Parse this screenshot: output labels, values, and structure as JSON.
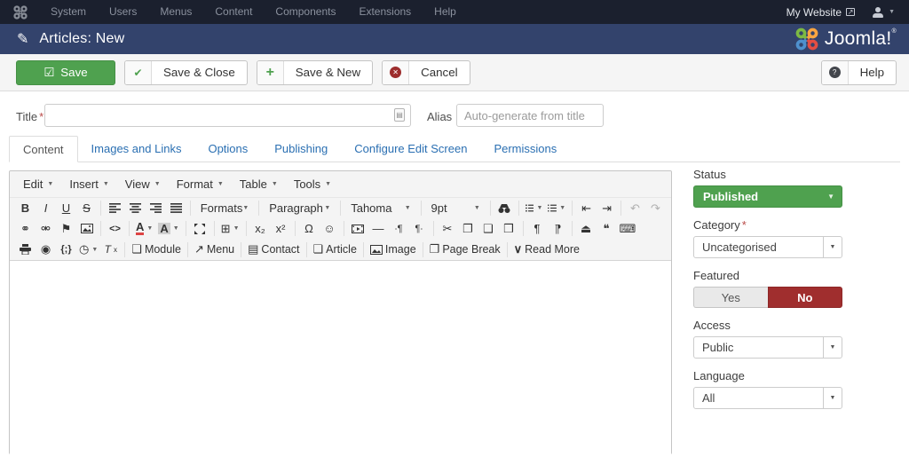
{
  "topbar": {
    "menu": [
      "System",
      "Users",
      "Menus",
      "Content",
      "Components",
      "Extensions",
      "Help"
    ],
    "site_link": "My Website"
  },
  "header": {
    "title": "Articles: New",
    "logo_text": "Joomla!",
    "logo_reg": "®"
  },
  "toolbar": {
    "save": "Save",
    "save_close": "Save & Close",
    "save_new": "Save & New",
    "cancel": "Cancel",
    "help": "Help"
  },
  "form": {
    "title_label": "Title",
    "required_mark": "*",
    "alias_label": "Alias",
    "alias_placeholder": "Auto-generate from title"
  },
  "tabs": [
    "Content",
    "Images and Links",
    "Options",
    "Publishing",
    "Configure Edit Screen",
    "Permissions"
  ],
  "editor": {
    "menubar": [
      "Edit",
      "Insert",
      "View",
      "Format",
      "Table",
      "Tools"
    ],
    "dropdowns": {
      "formats": "Formats",
      "paragraph": "Paragraph",
      "font": "Tahoma",
      "size": "9pt"
    },
    "insert_buttons": {
      "module": "Module",
      "menu": "Menu",
      "contact": "Contact",
      "article": "Article",
      "image": "Image",
      "page_break": "Page Break",
      "read_more": "Read More"
    }
  },
  "icons": {
    "caret": "▼",
    "pencil": "✎",
    "external_arrow": "↗",
    "save_check": "☑",
    "check": "✔",
    "plus": "+",
    "cross": "✕",
    "question": "?",
    "bold": "B",
    "italic": "I",
    "underline": "U",
    "strike": "S",
    "undo": "↶",
    "redo": "↷",
    "outdent": "⇤",
    "indent": "⇥",
    "link": "⚭",
    "unlink": "⚮",
    "anchor": "⚑",
    "code": "<>",
    "forecolor": "A",
    "backcolor": "A",
    "table": "⊞",
    "subscript": "x₂",
    "superscript": "x²",
    "omega": "Ω",
    "smiley": "☺",
    "hr": "—",
    "nbsp_before": "∙¶",
    "nbsp_after": "¶∙",
    "cut": "✂",
    "copy": "❐",
    "paste": "❑",
    "paste_text": "❒",
    "paragraph_ltr": "¶",
    "paragraph_rtl": "¶",
    "page_up": "⏏",
    "blockquote": "❝",
    "template": "⌨",
    "preview": "◉",
    "source_code": "{;}",
    "clock": "◷",
    "clear_t": "T",
    "clear_x": "x",
    "module": "❏",
    "menu_out": "↗",
    "contact": "▤",
    "article": "❏",
    "pagebreak": "❐",
    "readmore": "∨",
    "field_addon": "▤"
  },
  "sidebar": {
    "status_label": "Status",
    "status_value": "Published",
    "category_label": "Category",
    "category_required": "*",
    "category_value": "Uncategorised",
    "featured_label": "Featured",
    "featured_yes": "Yes",
    "featured_no": "No",
    "access_label": "Access",
    "access_value": "Public",
    "language_label": "Language",
    "language_value": "All"
  },
  "colors": {
    "topbar_bg": "#1b202e",
    "header_bg": "#33436c",
    "accent_green": "#4fa14f",
    "featured_no_bg": "#a02e2e",
    "cancel_red": "#9d2d2d",
    "link_blue": "#2a6fb2"
  }
}
